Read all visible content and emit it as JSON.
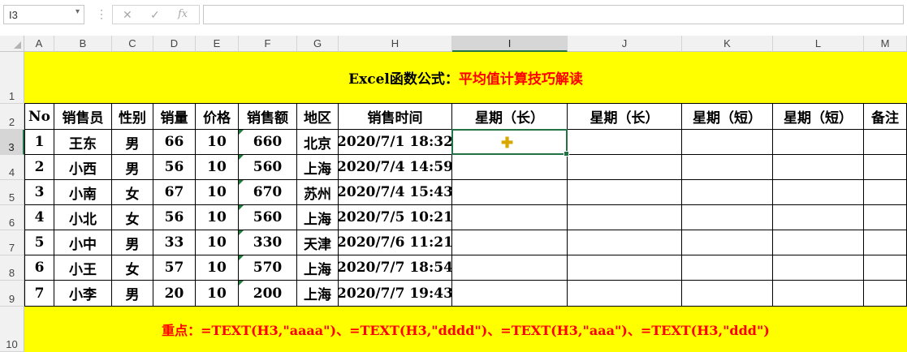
{
  "formula_bar": {
    "name_box": "I3",
    "dropdown": "▾",
    "dots": "⋮",
    "cancel": "✕",
    "enter": "✓",
    "fx": "fx",
    "formula": ""
  },
  "columns": [
    "A",
    "B",
    "C",
    "D",
    "E",
    "F",
    "G",
    "H",
    "I",
    "J",
    "K",
    "L",
    "M"
  ],
  "rows": [
    "1",
    "2",
    "3",
    "4",
    "5",
    "6",
    "7",
    "8",
    "9",
    "10"
  ],
  "title": {
    "prefix": "Excel函数公式：",
    "main": "平均值计算技巧解读"
  },
  "headers": [
    "No",
    "销售员",
    "性别",
    "销量",
    "价格",
    "销售额",
    "地区",
    "销售时间",
    "星期（长）",
    "星期（长）",
    "星期（短）",
    "星期（短）",
    "备注"
  ],
  "data_rows": [
    [
      "1",
      "王东",
      "男",
      "66",
      "10",
      "660",
      "北京",
      "2020/7/1 18:32",
      "",
      "",
      "",
      "",
      ""
    ],
    [
      "2",
      "小西",
      "男",
      "56",
      "10",
      "560",
      "上海",
      "2020/7/4 14:59",
      "",
      "",
      "",
      "",
      ""
    ],
    [
      "3",
      "小南",
      "女",
      "67",
      "10",
      "670",
      "苏州",
      "2020/7/4 15:43",
      "",
      "",
      "",
      "",
      ""
    ],
    [
      "4",
      "小北",
      "女",
      "56",
      "10",
      "560",
      "上海",
      "2020/7/5 10:21",
      "",
      "",
      "",
      "",
      ""
    ],
    [
      "5",
      "小中",
      "男",
      "33",
      "10",
      "330",
      "天津",
      "2020/7/6 11:21",
      "",
      "",
      "",
      "",
      ""
    ],
    [
      "6",
      "小王",
      "女",
      "57",
      "10",
      "570",
      "上海",
      "2020/7/7 18:54",
      "",
      "",
      "",
      "",
      ""
    ],
    [
      "7",
      "小李",
      "男",
      "20",
      "10",
      "200",
      "上海",
      "2020/7/7 19:43",
      "",
      "",
      "",
      "",
      ""
    ]
  ],
  "note": {
    "label": "重点：",
    "text": "=TEXT(H3,\"aaaa\")、=TEXT(H3,\"dddd\")、=TEXT(H3,\"aaa\")、=TEXT(H3,\"ddd\")"
  },
  "colors": {
    "highlight": "#ffff00",
    "accent_red": "#ff0000",
    "selection_green": "#217346"
  }
}
